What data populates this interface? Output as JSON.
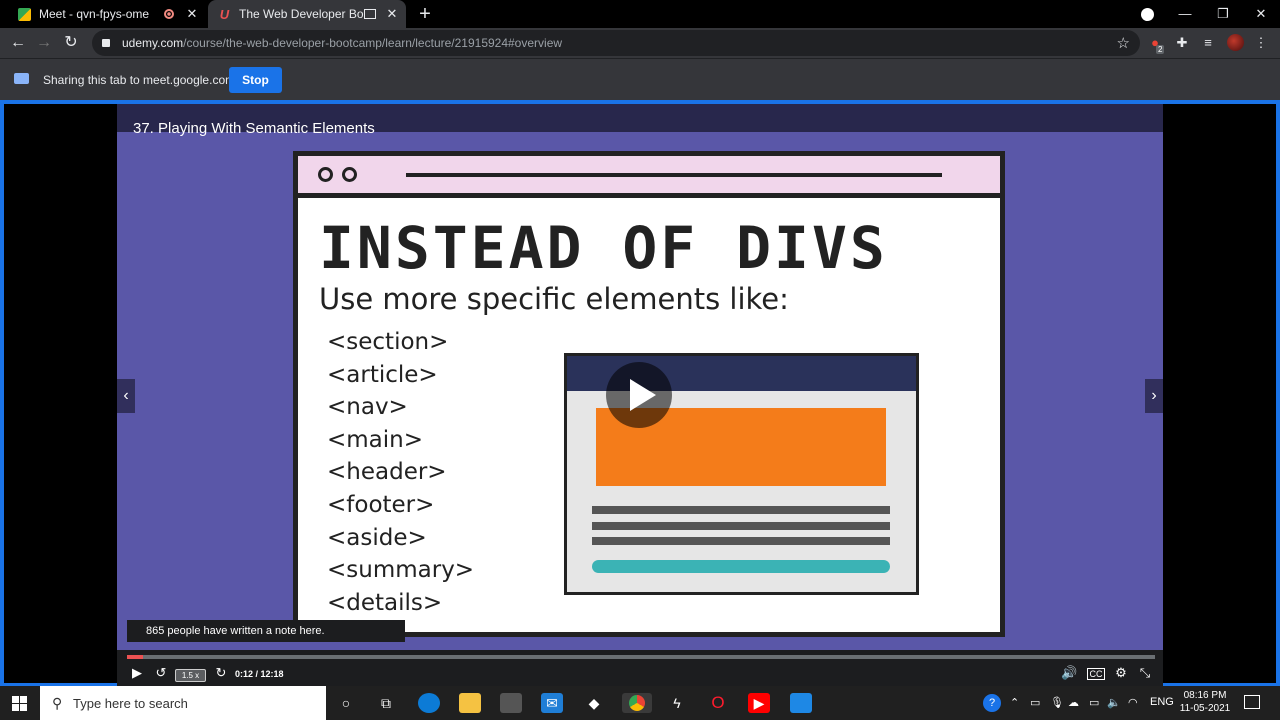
{
  "browser": {
    "tabs": [
      {
        "title": "Meet - qvn-fpys-ome"
      },
      {
        "title": "The Web Developer Bootcam"
      }
    ],
    "url_host": "udemy.com",
    "url_path": "/course/the-web-developer-bootcamp/learn/lecture/21915924#overview",
    "ext_badge": "2"
  },
  "sharing": {
    "text": "Sharing this tab to meet.google.com",
    "stop_label": "Stop"
  },
  "player": {
    "lecture_title": "37. Playing With Semantic Elements",
    "note_text": "865 people have written a note here.",
    "speed": "1.5 x",
    "time": "0:12 / 12:18",
    "progress": 0.016
  },
  "slide": {
    "heading": "INSTEAD OF DIVS",
    "subheading": "Use more specific elements like:",
    "tags": [
      "<section>",
      "<article>",
      "<nav>",
      "<main>",
      "<header>",
      "<footer>",
      "<aside>",
      "<summary>",
      "<details>"
    ]
  },
  "taskbar": {
    "search_placeholder": "Type here to search",
    "lang": "ENG",
    "time": "08:16 PM",
    "date": "11-05-2021"
  },
  "colors": {
    "accent": "#1a73e8",
    "video_bg": "#5a57a8",
    "udemy_red": "#ec5252",
    "orange": "#f47c1a",
    "teal": "#3bb3b5"
  }
}
